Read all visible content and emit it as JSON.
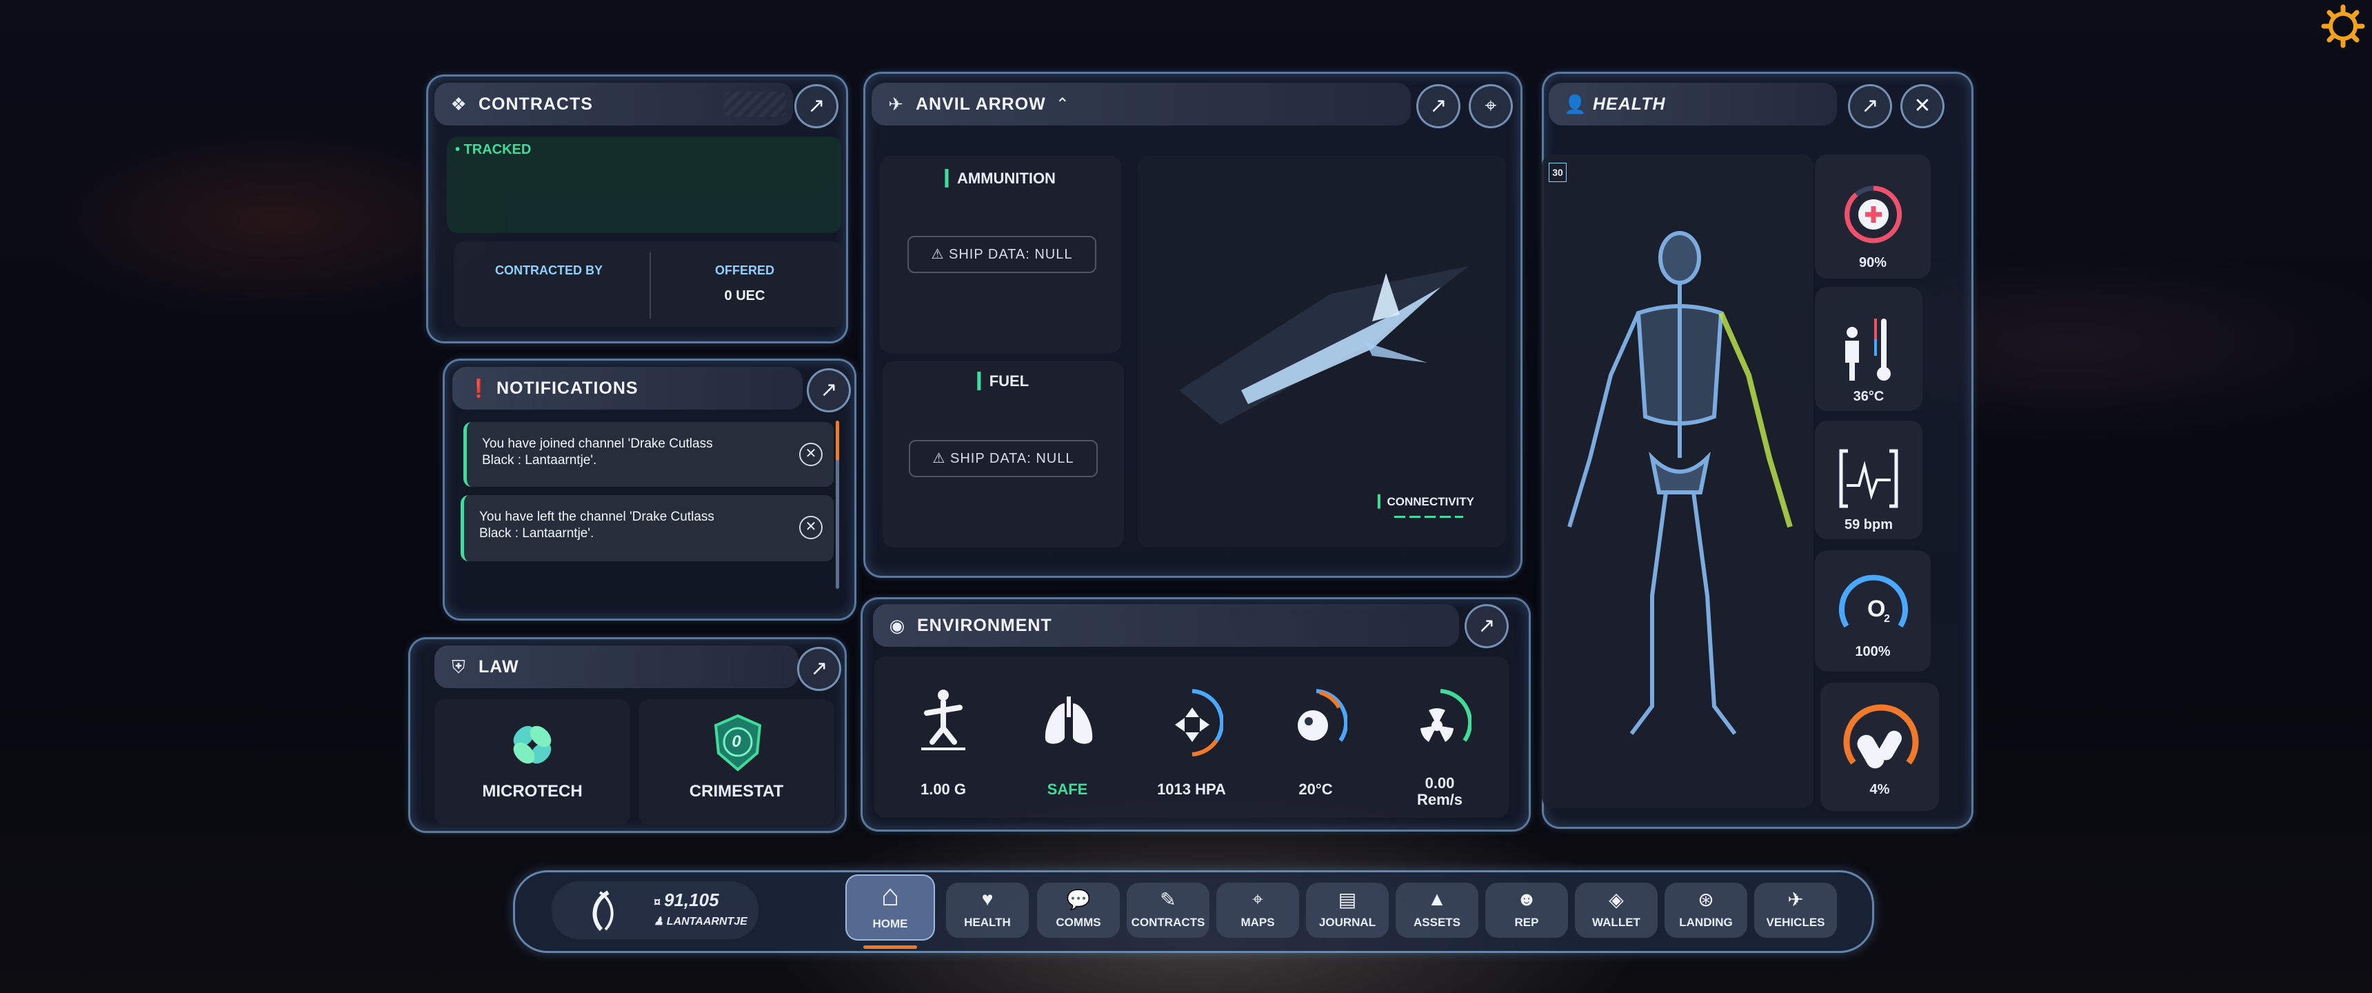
{
  "contracts": {
    "title": "CONTRACTS",
    "tracked": "• TRACKED",
    "contracted_by_label": "CONTRACTED BY",
    "offered_label": "OFFERED",
    "offered_value": "0 UEC"
  },
  "notifications": {
    "title": "NOTIFICATIONS",
    "items": [
      {
        "line1": "You have joined channel 'Drake Cutlass",
        "line2": "Black : Lantaarntje'."
      },
      {
        "line1": "You have left the channel 'Drake Cutlass",
        "line2": "Black : Lantaarntje'."
      }
    ]
  },
  "law": {
    "title": "LAW",
    "items": [
      {
        "label": "MICROTECH"
      },
      {
        "label": "CRIMESTAT",
        "value": "0"
      }
    ]
  },
  "ship": {
    "title": "ANVIL ARROW",
    "ammo_label": "AMMUNITION",
    "fuel_label": "FUEL",
    "null_text": "SHIP DATA: NULL",
    "connectivity": "CONNECTIVITY"
  },
  "environment": {
    "title": "ENVIRONMENT",
    "items": [
      {
        "icon": "gravity-icon",
        "value": "1.00 G"
      },
      {
        "icon": "lungs-icon",
        "value": "SAFE"
      },
      {
        "icon": "pressure-icon",
        "value": "1013 HPA"
      },
      {
        "icon": "temperature-icon",
        "value": "20°C"
      },
      {
        "icon": "radiation-icon",
        "value": "0.00",
        "value2": "Rem/s"
      }
    ]
  },
  "health": {
    "title": "HEALTH",
    "badge": "30",
    "health_pct": "90%",
    "body_temp": "36°C",
    "heart_rate": "59 bpm",
    "oxygen": "100%",
    "drug": "4%",
    "o2_label": "O"
  },
  "player": {
    "balance": "91,105",
    "name": "LANTAARNTJE"
  },
  "nav": {
    "items": [
      {
        "label": "HOME",
        "icon": "home-icon"
      },
      {
        "label": "HEALTH",
        "icon": "heart-icon"
      },
      {
        "label": "COMMS",
        "icon": "chat-icon"
      },
      {
        "label": "CONTRACTS",
        "icon": "contracts-icon"
      },
      {
        "label": "MAPS",
        "icon": "map-icon"
      },
      {
        "label": "JOURNAL",
        "icon": "journal-icon"
      },
      {
        "label": "ASSETS",
        "icon": "assets-icon"
      },
      {
        "label": "REP",
        "icon": "rep-icon"
      },
      {
        "label": "WALLET",
        "icon": "wallet-icon"
      },
      {
        "label": "LANDING",
        "icon": "landing-icon"
      },
      {
        "label": "VEHICLES",
        "icon": "vehicles-icon"
      }
    ]
  },
  "colors": {
    "accent_green": "#3fdc9a",
    "accent_blue": "#4aa8ff",
    "accent_orange": "#f07a2a",
    "accent_red": "#f0506a"
  }
}
